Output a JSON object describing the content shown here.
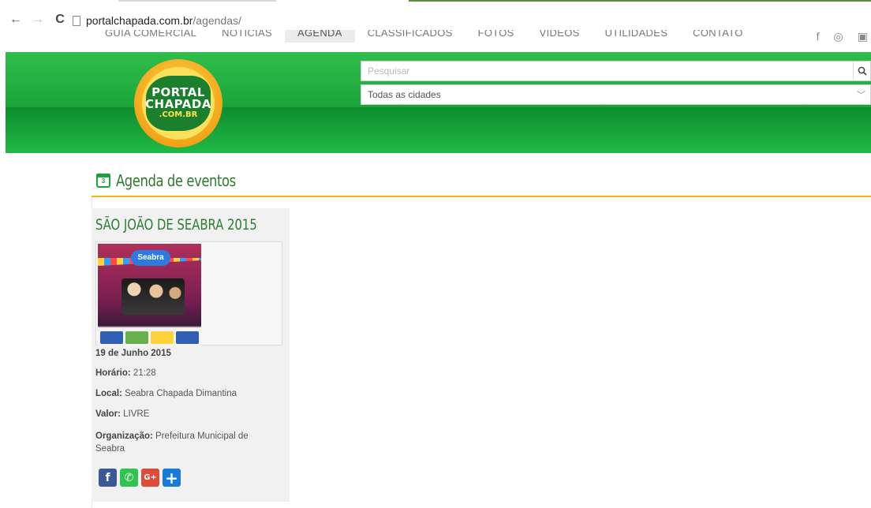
{
  "browser": {
    "url_domain": "portalchapada.com.br",
    "url_path": "/agendas/",
    "back": "←",
    "forward": "→",
    "reload": "C"
  },
  "topnav": {
    "items": [
      "GUIA COMERCIAL",
      "NOTÍCIAS",
      "AGENDA",
      "CLASSIFICADOS",
      "FOTOS",
      "VÍDEOS",
      "UTILIDADES",
      "CONTATO"
    ],
    "active": "AGENDA",
    "social": [
      "f",
      "◎",
      "▣"
    ]
  },
  "logo": {
    "line1": "PORTAL",
    "line2": "CHAPADA",
    "line3": ".COM.BR"
  },
  "search": {
    "placeholder": "Pesquisar",
    "button_icon": "search-icon"
  },
  "city_select": {
    "selected": "Todas as cidades",
    "icon": "chevron-down-icon"
  },
  "agenda": {
    "title": "Agenda de eventos",
    "icon_day": "3"
  },
  "event": {
    "title": "SÃO JOÃO DE SEABRA 2015",
    "poster_label": "Seabra",
    "date": "19 de Junho 2015",
    "time_label": "Horário:",
    "time_value": " 21:28",
    "place_label": "Local:",
    "place_value": " Seabra Chapada Dimantina",
    "price_label": "Valor:",
    "price_value": " LIVRE",
    "org_label": "Organização:",
    "org_value": " Prefeitura Municipal de Seabra"
  },
  "share": {
    "facebook": "f",
    "whatsapp": "✆",
    "googleplus": "G+",
    "more": "+"
  },
  "colors": {
    "header_green": "#1aa43a",
    "accent_yellow": "#f3b51d",
    "title_green": "#2e7d32"
  }
}
